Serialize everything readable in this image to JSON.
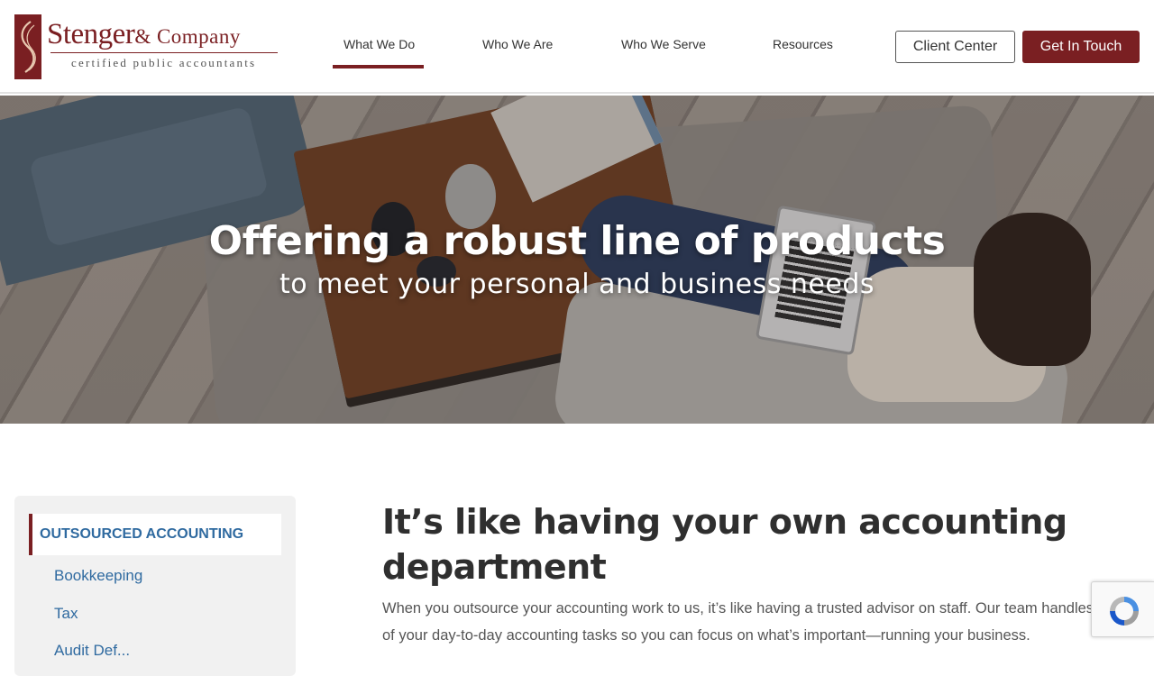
{
  "brand": {
    "name": "Stenger",
    "name_suffix": "& Company",
    "tagline": "certified public accountants",
    "accent_color": "#7a1f22",
    "link_color": "#2f6aa0"
  },
  "nav": {
    "items": [
      {
        "label": "What We Do",
        "active": true
      },
      {
        "label": "Who We Are",
        "active": false
      },
      {
        "label": "Who We Serve",
        "active": false
      },
      {
        "label": "Resources",
        "active": false
      }
    ],
    "client_center_label": "Client Center",
    "get_in_touch_label": "Get In Touch"
  },
  "hero": {
    "title": "Offering a robust line of products",
    "subtitle": "to meet your personal and business needs"
  },
  "sidebar": {
    "active_label": "OUTSOURCED ACCOUNTING",
    "items": [
      {
        "label": "Bookkeeping"
      },
      {
        "label": "Tax"
      },
      {
        "label": "Audit Def..."
      }
    ]
  },
  "main": {
    "heading": "It’s like having your own accounting department",
    "body_line_1": "When you outsource your accounting work to us, it’s like having a trusted advisor on staff. Our team handles",
    "body_line_2": "of your day-to-day accounting tasks so you can focus on what’s important—running your business."
  },
  "recaptcha": {
    "icon": "recaptcha-icon"
  }
}
